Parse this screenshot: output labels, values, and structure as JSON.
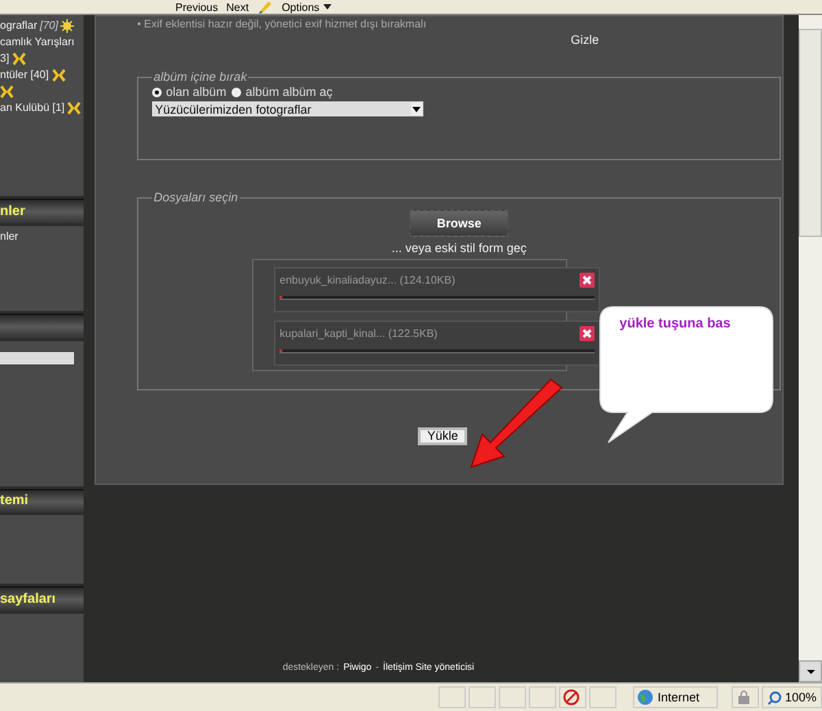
{
  "browser_toolbar": {
    "buttons": [
      {
        "label": "Previous"
      },
      {
        "label": "Next"
      }
    ],
    "options": "Options"
  },
  "sidebar": [
    {
      "kind": "panel",
      "lines": [
        {
          "text": "ograflar",
          "count": "[70]",
          "kind": "sun"
        },
        {
          "text": "camlık Yarışları",
          "kind": "plain"
        },
        {
          "text": "3]",
          "kind": "sparkle"
        },
        {
          "text": "ntüler [40]",
          "kind": "sparkle"
        },
        {
          "kind": "sparkle"
        },
        {
          "text": "an Kulübü [1]",
          "kind": "sparkle"
        }
      ]
    },
    {
      "kind": "header",
      "title": "nler"
    },
    {
      "kind": "panel",
      "lines": [
        {
          "text": "nler",
          "kind": "plain"
        }
      ]
    },
    {
      "kind": "header"
    },
    {
      "kind": "field"
    },
    {
      "kind": "header",
      "title": "temi"
    },
    {
      "kind": "panel"
    },
    {
      "kind": "header",
      "title": "sayfaları"
    },
    {
      "kind": "panel"
    }
  ],
  "notice": "• Exif eklentisi hazır değil, yönetici exif hizmet dışı bırakmalı",
  "hide_link": "Gizle",
  "album_group": {
    "legend": "albüm içine bırak",
    "options": [
      {
        "label": "olan albüm",
        "selected": true
      },
      {
        "label": "albüm albüm aç",
        "selected": false
      }
    ],
    "album_select": "Yüzücülerimizden fotograflar"
  },
  "files_group": {
    "legend": "Dosyaları seçin",
    "browse": "Browse",
    "alt_link": "... veya eski stil form geç",
    "files": [
      {
        "name": "enbuyuk_kinaliadayuz...",
        "size": "(124.10KB)",
        "level": 0.01
      },
      {
        "name": "kupalari_kapti_kinal...",
        "size": "(122.5KB)",
        "level": 0.01
      }
    ]
  },
  "upload_button": "Yükle",
  "callout": "yükle tuşuna bas",
  "footer": {
    "prefix": "destekleyen :",
    "link1": "Piwigo",
    "sep": "-",
    "link2": "İletişim Site yöneticisi"
  },
  "status_bar": {
    "zone": "Internet",
    "zoom": "100%"
  }
}
